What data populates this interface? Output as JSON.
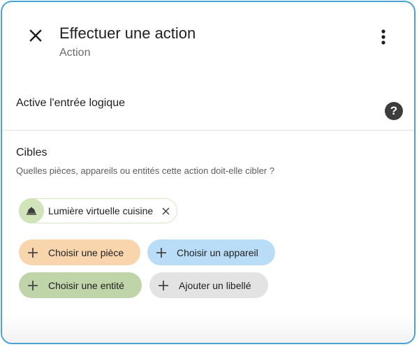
{
  "dialog": {
    "title": "Effectuer une action",
    "subtitle": "Action",
    "close_icon": "close-icon",
    "menu_icon": "more-vertical-icon"
  },
  "action": {
    "label": "Active l'entrée logique",
    "help_icon": "help-icon",
    "help_glyph": "?"
  },
  "targets": {
    "title": "Cibles",
    "description": "Quelles pièces, appareils ou entités cette action doit-elle cibler ?",
    "selected": [
      {
        "label": "Lumière virtuelle cuisine",
        "icon": "bell-icon",
        "remove_icon": "close-icon"
      }
    ],
    "buttons": {
      "area": "Choisir une pièce",
      "device": "Choisir un appareil",
      "entity": "Choisir une entité",
      "label": "Ajouter un libellé"
    }
  },
  "colors": {
    "frame_border": "#4aa3d8",
    "area_button": "#f8d5ad",
    "device_button": "#b9ddf6",
    "entity_button": "#bfd4a8",
    "label_button": "#e3e3e3",
    "chip_icon_bg": "#cfe5b9"
  }
}
